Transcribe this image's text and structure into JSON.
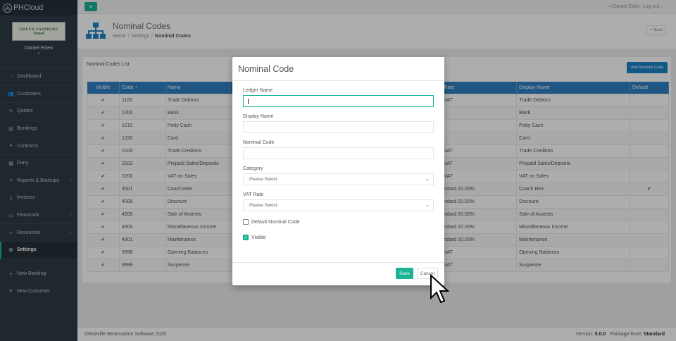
{
  "brand": {
    "name": "PHCloud"
  },
  "profile": {
    "company_top": "GREEN SAPPHIRE",
    "company_bottom": "Travel",
    "user_name": "Daniel Eden",
    "caret": "▾"
  },
  "sidebar": {
    "items": [
      {
        "label": "Dashboard",
        "icon": "tachometer-icon",
        "glyph": "◔",
        "has_chevron": false
      },
      {
        "label": "Customers",
        "icon": "users-icon",
        "glyph": "👥",
        "has_chevron": false
      },
      {
        "label": "Quotes",
        "icon": "pencil-icon",
        "glyph": "✎",
        "has_chevron": false
      },
      {
        "label": "Bookings",
        "icon": "book-icon",
        "glyph": "▤",
        "has_chevron": false
      },
      {
        "label": "Contracts",
        "icon": "handshake-icon",
        "glyph": "⚭",
        "has_chevron": false
      },
      {
        "label": "Diary",
        "icon": "calendar-icon",
        "glyph": "▦",
        "has_chevron": false
      },
      {
        "label": "Reports & Backups",
        "icon": "chart-icon",
        "glyph": "↗",
        "has_chevron": true
      },
      {
        "label": "Invoices",
        "icon": "file-icon",
        "glyph": "▯",
        "has_chevron": false
      },
      {
        "label": "Financials",
        "icon": "money-icon",
        "glyph": "▭",
        "has_chevron": true
      },
      {
        "label": "Resources",
        "icon": "folder-icon",
        "glyph": "▱",
        "has_chevron": true
      },
      {
        "label": "Settings",
        "icon": "cogs-icon",
        "glyph": "⚙",
        "has_chevron": false
      }
    ],
    "extra": [
      {
        "label": "New Booking",
        "glyph": "+"
      },
      {
        "label": "New Customer",
        "glyph": "+"
      }
    ],
    "chevron": "‹"
  },
  "topbar": {
    "menu_glyph": "≡",
    "user_text": "Daniel Eden, Log out..."
  },
  "heading": {
    "title": "Nominal Codes",
    "breadcrumb": [
      "Home",
      "Settings",
      "Nominal Codes"
    ],
    "sep": "/",
    "back_label": "↶ Back"
  },
  "panel": {
    "title": "Nominal Codes List",
    "add_label": "Add Nominal Code"
  },
  "table": {
    "columns": [
      "Visible",
      "Code ↑",
      "Name",
      "",
      "Rate",
      "Display Name",
      "Default"
    ],
    "rows": [
      {
        "visible": "✔",
        "code": "1100",
        "name": "Trade Debtors",
        "rate": "VAT",
        "display": "Trade Debtors",
        "default": ""
      },
      {
        "visible": "✔",
        "code": "1200",
        "name": "Bank",
        "rate": "",
        "display": "Bank",
        "default": ""
      },
      {
        "visible": "✔",
        "code": "1210",
        "name": "Petty Cash",
        "rate": "",
        "display": "Petty Cash",
        "default": ""
      },
      {
        "visible": "✔",
        "code": "1220",
        "name": "Card",
        "rate": "",
        "display": "Card",
        "default": ""
      },
      {
        "visible": "✔",
        "code": "2100",
        "name": "Trade Creditors",
        "rate": "VAT",
        "display": "Trade Creditors",
        "default": ""
      },
      {
        "visible": "✔",
        "code": "2102",
        "name": "Prepaid Sales/Deposits",
        "rate": "VAT",
        "display": "Prepaid Sales/Deposits",
        "default": ""
      },
      {
        "visible": "✔",
        "code": "2200",
        "name": "VAT on Sales",
        "rate": "VAT",
        "display": "VAT on Sales",
        "default": ""
      },
      {
        "visible": "✔",
        "code": "4001",
        "name": "Coach Hire",
        "rate": "ndard 20.00%",
        "display": "Coach Hire",
        "default": "✔"
      },
      {
        "visible": "✔",
        "code": "4009",
        "name": "Discount",
        "rate": "ndard 20.00%",
        "display": "Discount",
        "default": ""
      },
      {
        "visible": "✔",
        "code": "4200",
        "name": "Sale of Assests",
        "rate": "ndard 20.00%",
        "display": "Sale of Assests",
        "default": ""
      },
      {
        "visible": "✔",
        "code": "4900",
        "name": "Miscellaneous Income",
        "rate": "ndard 20.00%",
        "display": "Miscellaneous Income",
        "default": ""
      },
      {
        "visible": "✔",
        "code": "4901",
        "name": "Maintenance",
        "rate": "ndard 20.00%",
        "display": "Maintenance",
        "default": ""
      },
      {
        "visible": "✔",
        "code": "9998",
        "name": "Opening Balances",
        "rate": "VAT",
        "display": "Opening Balances",
        "default": ""
      },
      {
        "visible": "✔",
        "code": "9999",
        "name": "Suspense",
        "rate": "VAT",
        "display": "Suspense",
        "default": ""
      }
    ]
  },
  "footer": {
    "copyright": "©Roeville Reservation Software 2020",
    "version_label": "Version:",
    "version": "5.0.0",
    "package_label": "Package level:",
    "package": "Standard"
  },
  "modal": {
    "title": "Nominal Code",
    "ledger_label": "Ledger Name",
    "ledger_value": "",
    "display_label": "Display Name",
    "display_value": "",
    "code_label": "Nominal Code",
    "code_value": "",
    "category_label": "Category",
    "category_value": "Please Select",
    "vat_label": "VAT Rate",
    "vat_value": "Please Select",
    "default_label": "Default Nominal Code",
    "default_checked": false,
    "visible_label": "Visible",
    "visible_checked": true,
    "save_label": "Save",
    "cancel_label": "Cancel",
    "dropdown_glyph": "⌄",
    "check_glyph": "✓"
  },
  "colors": {
    "accent": "#1ab394",
    "primary": "#1c84c6",
    "sidebar": "#2f3a46",
    "table_header": "#2f7fc1"
  }
}
